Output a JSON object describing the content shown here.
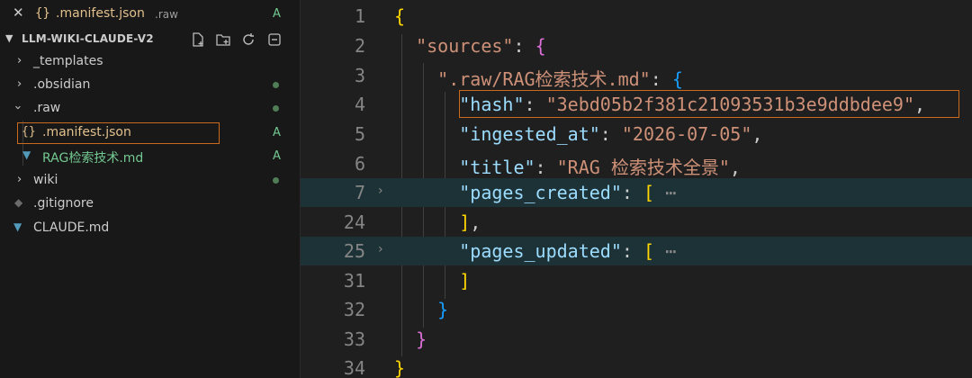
{
  "open_editor": {
    "close_glyph": "✕",
    "icon_text": "{}",
    "filename": ".manifest.json",
    "description": ".raw",
    "status": "A"
  },
  "explorer": {
    "title": "LLM-WIKI-CLAUDE-V2",
    "tools": [
      "new-file-icon",
      "new-folder-icon",
      "refresh-icon",
      "collapse-all-icon"
    ],
    "items": [
      {
        "label": "_templates",
        "type": "folder"
      },
      {
        "label": ".obsidian",
        "type": "folder"
      },
      {
        "label": ".raw",
        "type": "folder-open"
      },
      {
        "label": ".manifest.json",
        "type": "json",
        "icon_text": "{}",
        "status": "A"
      },
      {
        "label": "RAG检索技术.md",
        "type": "markdown",
        "status": "A"
      },
      {
        "label": "wiki",
        "type": "folder"
      },
      {
        "label": ".gitignore",
        "type": "git"
      },
      {
        "label": "CLAUDE.md",
        "type": "markdown"
      }
    ]
  },
  "editor": {
    "lines": [
      {
        "n": "1"
      },
      {
        "n": "2"
      },
      {
        "n": "3"
      },
      {
        "n": "4"
      },
      {
        "n": "5"
      },
      {
        "n": "6"
      },
      {
        "n": "7"
      },
      {
        "n": "24"
      },
      {
        "n": "25"
      },
      {
        "n": "31"
      },
      {
        "n": "32"
      },
      {
        "n": "33"
      },
      {
        "n": "34"
      }
    ],
    "tokens": {
      "sources_key": "\"sources\"",
      "file_key": "\".raw/RAG检索技术.md\"",
      "hash_key": "\"hash\"",
      "hash_val": "\"3ebd05b2f381c21093531b3e9ddbdee9\"",
      "ingested_key": "\"ingested_at\"",
      "ingested_val": "\"2026-07-05\"",
      "title_key": "\"title\"",
      "title_val": "\"RAG 检索技术全景\"",
      "pages_created_key": "\"pages_created\"",
      "pages_updated_key": "\"pages_updated\"",
      "ellipsis": "⋯"
    },
    "colors": {
      "key": "#9cdcfe",
      "string": "#ce9178",
      "bracket1": "#ffd700",
      "bracket2": "#da70d6",
      "bracket3": "#179fff",
      "highlight_border": "#c86b1e"
    }
  }
}
